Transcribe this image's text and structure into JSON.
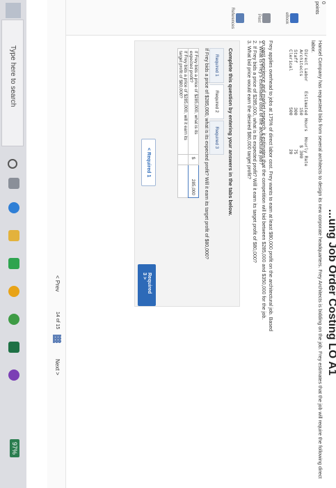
{
  "header": {
    "title_fragment": "...ung Job Order Costing LO A1"
  },
  "left": {
    "points": "0\npoints",
    "buttons": [
      {
        "label": "eBook"
      },
      {
        "label": "Print"
      },
      {
        "label": "References"
      }
    ]
  },
  "problem": {
    "intro": "Hansel Company has requested bids from several architects to design its new corporate headquarters. Frey Architects is bidding on the job. Frey estimates that the job will require the following direct labor.",
    "table": {
      "headers": [
        "Direct Labor",
        "Estimated Hours",
        "Hourly Rate"
      ],
      "rows": [
        [
          "Architects",
          "150",
          "$ 300"
        ],
        [
          "Staff",
          "300",
          "75"
        ],
        [
          "Clerical",
          "500",
          "20"
        ]
      ]
    },
    "overhead_text": "Frey applies overhead to jobs at 175% of direct labor cost. Frey wants to earn at least $80,000 profit on the architectural job. Based on past experience and market research, it estimates that the competition will bid between $285,000 and $350,000 for the job.",
    "questions": [
      "1. What is Frey's estimated cost of the architectural job?",
      "2. If Frey bids a price of $285,000, what is its expected profit? Will it earn its target profit of $80,000?",
      "3. What bid price would earn the desired $80,000 target profit?"
    ]
  },
  "work": {
    "instructions": "Complete this question by entering your answers in the tabs below.",
    "tabs": [
      "Required 1",
      "Required 2",
      "Required 3"
    ],
    "question": "If Frey bids a price of $285,000, what is its expected profit? Will it earn its target profit of $80,000?",
    "rows": [
      {
        "label": "If Frey bids a price of $285,000, what is its expected profit?",
        "currency": "$",
        "value": "285,000"
      },
      {
        "label": "If Frey bids a price of $285,000, will it earn its target profit of $80,000?",
        "currency": "",
        "value": ""
      }
    ],
    "prev_label": "< Required 1",
    "next_label": "Required 3 >"
  },
  "pager": {
    "prev": "< Prev",
    "count": "14 of 15",
    "next": "Next >"
  },
  "taskbar": {
    "search_placeholder": "Type here to search",
    "battery": "97%"
  },
  "colors": {
    "accent": "#2d6ab8",
    "taskbar": "#dcdde2"
  }
}
